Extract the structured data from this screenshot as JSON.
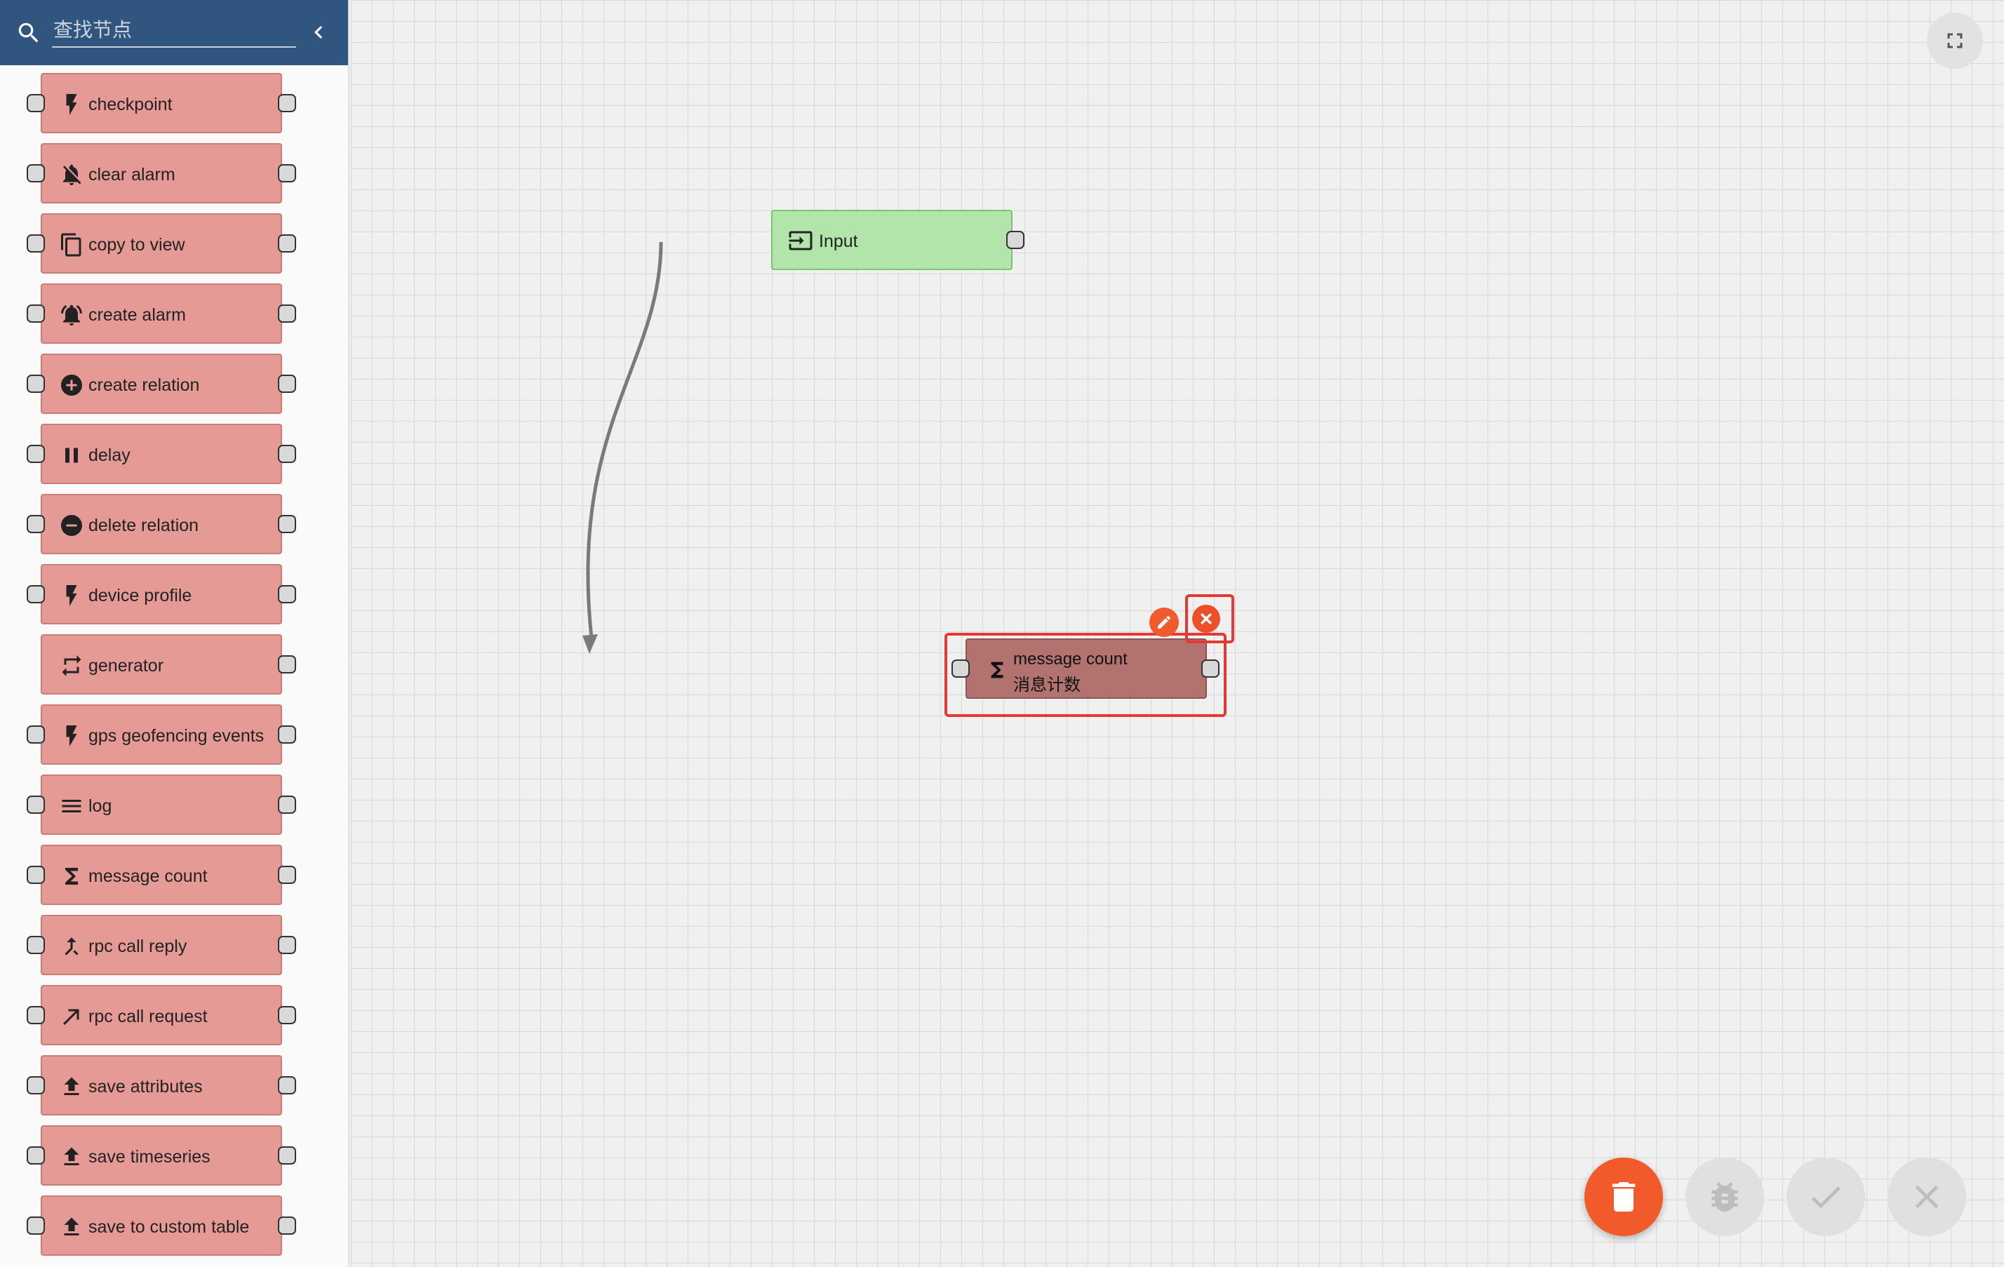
{
  "search": {
    "placeholder": "查找节点",
    "value": ""
  },
  "palette": {
    "items": [
      {
        "label": "checkpoint",
        "icon": "flash-icon"
      },
      {
        "label": "clear alarm",
        "icon": "notifications-off-icon"
      },
      {
        "label": "copy to view",
        "icon": "content-copy-icon"
      },
      {
        "label": "create alarm",
        "icon": "notifications-active-icon"
      },
      {
        "label": "create relation",
        "icon": "add-circle-icon"
      },
      {
        "label": "delay",
        "icon": "pause-icon"
      },
      {
        "label": "delete relation",
        "icon": "remove-circle-icon"
      },
      {
        "label": "device profile",
        "icon": "flash-icon"
      },
      {
        "label": "generator",
        "icon": "repeat-icon"
      },
      {
        "label": "gps geofencing events",
        "icon": "flash-icon"
      },
      {
        "label": "log",
        "icon": "menu-lines-icon"
      },
      {
        "label": "message count",
        "icon": "sigma-icon"
      },
      {
        "label": "rpc call reply",
        "icon": "call-merge-icon"
      },
      {
        "label": "rpc call request",
        "icon": "call-made-icon"
      },
      {
        "label": "save attributes",
        "icon": "file-upload-icon"
      },
      {
        "label": "save timeseries",
        "icon": "file-upload-icon"
      },
      {
        "label": "save to custom table",
        "icon": "file-upload-icon"
      }
    ]
  },
  "canvas": {
    "input_node": {
      "label": "Input",
      "icon": "input-icon"
    },
    "selected_node": {
      "type_label": "message count",
      "name": "消息计数",
      "icon": "sigma-icon"
    }
  },
  "colors": {
    "header": "#305680",
    "palette_node": "#e69a96",
    "input_node": "#b2e5a9",
    "selected_node": "#b27370",
    "highlight": "#e53935",
    "accent": "#f15a2b"
  },
  "actions": [
    "delete-icon",
    "bug-icon",
    "check-icon",
    "close-icon",
    "fullscreen-icon"
  ]
}
